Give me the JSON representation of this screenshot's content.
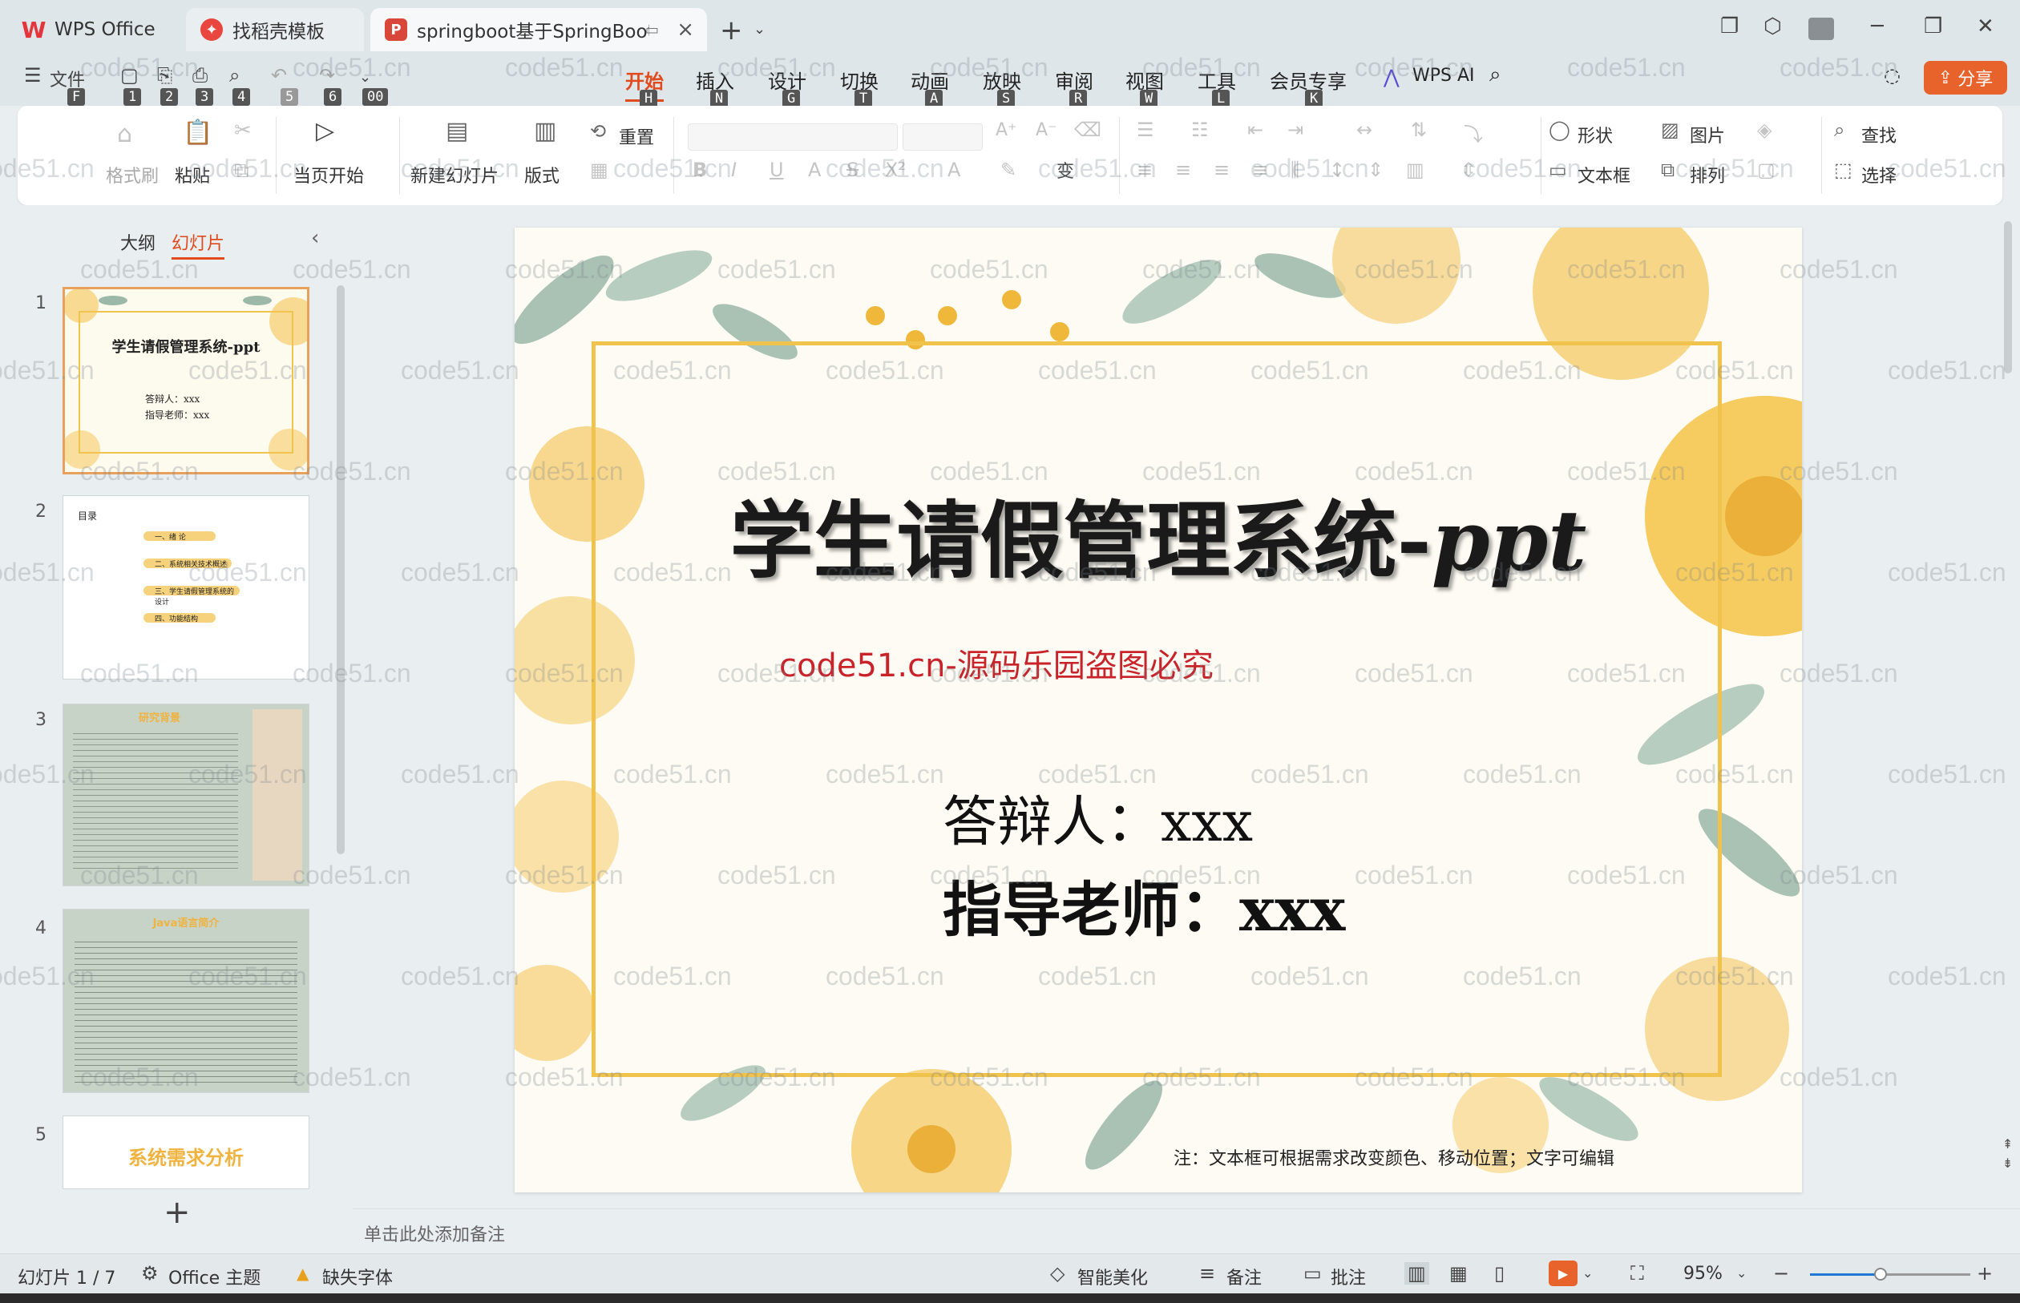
{
  "titlebar": {
    "tabs": [
      {
        "label": "WPS Office"
      },
      {
        "label": "找稻壳模板"
      },
      {
        "label": "springboot基于SpringBoot的"
      }
    ]
  },
  "quick_access": {
    "file_label": "文件",
    "keytips": [
      "F",
      "1",
      "2",
      "3",
      "4",
      "5",
      "6",
      "00"
    ]
  },
  "menu": {
    "items": [
      {
        "label": "开始",
        "key": "H"
      },
      {
        "label": "插入",
        "key": "N"
      },
      {
        "label": "设计",
        "key": "G"
      },
      {
        "label": "切换",
        "key": "T"
      },
      {
        "label": "动画",
        "key": "A"
      },
      {
        "label": "放映",
        "key": "S"
      },
      {
        "label": "审阅",
        "key": "R"
      },
      {
        "label": "视图",
        "key": "W"
      },
      {
        "label": "工具",
        "key": "L"
      },
      {
        "label": "会员专享",
        "key": "K"
      }
    ],
    "ai_label": "WPS AI",
    "share_label": "分享"
  },
  "ribbon": {
    "format_painter": "格式刷",
    "paste": "粘贴",
    "play_from_current": "当页开始",
    "new_slide": "新建幻灯片",
    "layout": "版式",
    "reset": "重置",
    "shape": "形状",
    "picture": "图片",
    "textbox": "文本框",
    "arrange": "排列",
    "find": "查找",
    "select": "选择"
  },
  "left_panel": {
    "outline_tab": "大纲",
    "slides_tab": "幻灯片",
    "slide_numbers": [
      "1",
      "2",
      "3",
      "4",
      "5"
    ],
    "thumb1": {
      "title": "学生请假管理系统-ppt",
      "line1": "答辩人：xxx",
      "line2": "指导老师：xxx"
    },
    "thumb2": {
      "title": "目录",
      "items": [
        "一、绪  论",
        "二、系统相关技术概述",
        "三、学生请假管理系统的设计",
        "四、功能结构"
      ]
    },
    "thumb3": {
      "title": "研究背景"
    },
    "thumb4": {
      "title": "Java语言简介"
    },
    "thumb5": {
      "title": "系统需求分析"
    }
  },
  "slide": {
    "title_main": "学生请假管理系统-",
    "title_em": "ppt",
    "watermark": "code51.cn-源码乐园盗图必究",
    "respondent": "答辩人：xxx",
    "advisor": "指导老师：xxx",
    "note": "注：文本框可根据需求改变颜色、移动位置；文字可编辑"
  },
  "notes": {
    "placeholder": "单击此处添加备注"
  },
  "statusbar": {
    "slide_counter": "幻灯片 1 / 7",
    "theme": "Office 主题",
    "missing_font": "缺失字体",
    "beautify": "智能美化",
    "notes": "备注",
    "comments": "批注",
    "zoom": "95%"
  },
  "watermark_text": "code51.cn",
  "colors": {
    "accent": "#e04a1c",
    "share": "#e8622c",
    "frame": "#f0c34c",
    "slide_watermark": "#c8232a"
  }
}
